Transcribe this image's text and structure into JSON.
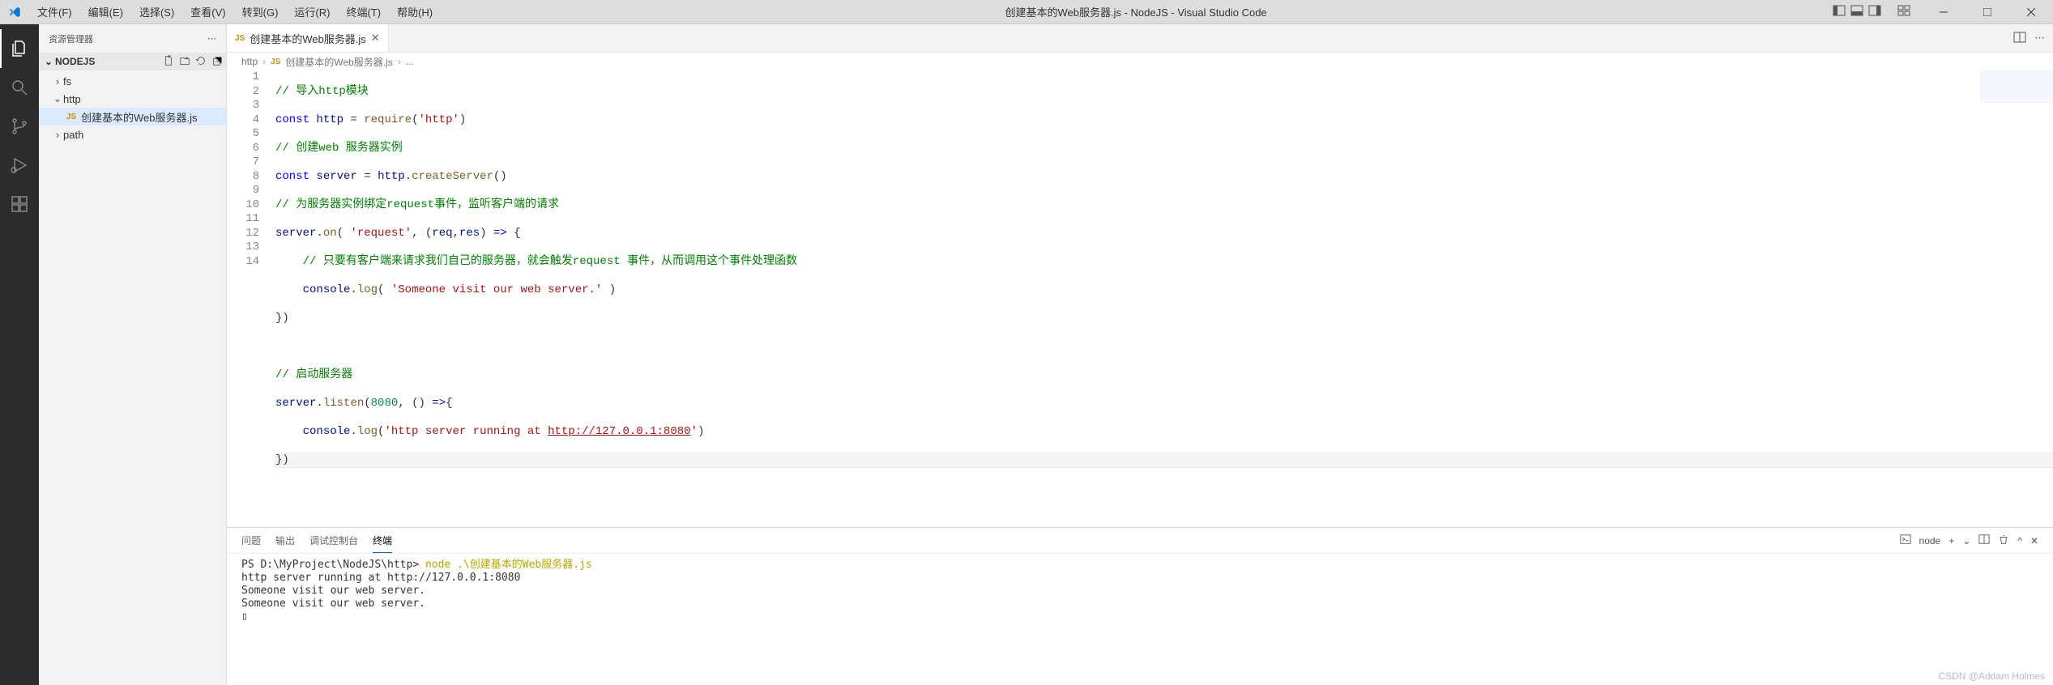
{
  "window": {
    "title": "创建基本的Web服务器.js - NodeJS - Visual Studio Code"
  },
  "menu": [
    "文件(F)",
    "编辑(E)",
    "选择(S)",
    "查看(V)",
    "转到(G)",
    "运行(R)",
    "终端(T)",
    "帮助(H)"
  ],
  "sidebar": {
    "title": "资源管理器",
    "project": "NODEJS",
    "items": [
      {
        "label": "fs",
        "kind": "folder"
      },
      {
        "label": "http",
        "kind": "folder",
        "expanded": true
      },
      {
        "label": "创建基本的Web服务器.js",
        "kind": "file",
        "selected": true
      },
      {
        "label": "path",
        "kind": "folder"
      }
    ]
  },
  "tab": {
    "icon": "JS",
    "label": "创建基本的Web服务器.js"
  },
  "breadcrumb": [
    "http",
    "创建基本的Web服务器.js",
    "..."
  ],
  "code_lines": 14,
  "panel": {
    "tabs": [
      "问题",
      "输出",
      "调试控制台",
      "终端"
    ],
    "active_tab": 3,
    "shell_label": "node",
    "terminal": {
      "prompt": "PS D:\\MyProject\\NodeJS\\http>",
      "cmd": "node .\\创建基本的Web服务器.js",
      "lines": [
        "http server running at http://127.0.0.1:8080",
        "Someone visit our web server.",
        "Someone visit our web server."
      ],
      "cursor": "▯"
    }
  },
  "watermark": "CSDN @Addam Holmes",
  "code": {
    "l1_comment": "// 导入http模块",
    "l2_k1": "const",
    "l2_v": "http",
    "l2_eq": " = ",
    "l2_fn": "require",
    "l2_s": "'http'",
    "l3_comment": "// 创建web 服务器实例",
    "l4_k1": "const",
    "l4_v": "server",
    "l4_eq": " = ",
    "l4_o": "http",
    "l4_fn": "createServer",
    "l5_comment": "// 为服务器实例绑定request事件，监听客户端的请求",
    "l6_o": "server",
    "l6_fn": "on",
    "l6_s": "'request'",
    "l6_p1": "req",
    "l6_p2": "res",
    "l7_comment": "// 只要有客户端来请求我们自己的服务器，就会触发request 事件，从而调用这个事件处理函数",
    "l8_o": "console",
    "l8_fn": "log",
    "l8_s": "'Someone visit our web server.'",
    "l11_comment": "// 启动服务器",
    "l12_o": "server",
    "l12_fn": "listen",
    "l12_n": "8080",
    "l13_o": "console",
    "l13_fn": "log",
    "l13_s1": "'http server running at ",
    "l13_s2": "http://127.0.0.1:8080",
    "l13_s3": "'"
  }
}
